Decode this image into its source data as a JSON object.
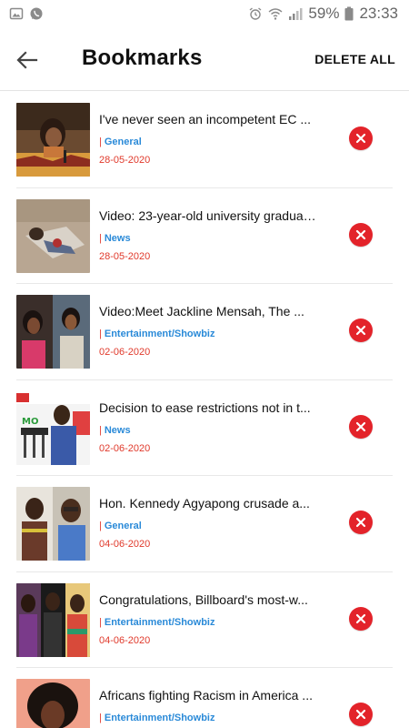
{
  "status_bar": {
    "battery_percent": "59%",
    "time": "23:33"
  },
  "header": {
    "title": "Bookmarks",
    "delete_all_label": "DELETE ALL"
  },
  "bookmarks": [
    {
      "title": "I've never seen an incompetent EC ...",
      "category": "General",
      "date": "28-05-2020"
    },
    {
      "title": "Video: 23-year-old university graduat...",
      "category": "News",
      "date": "28-05-2020"
    },
    {
      "title": "Video:Meet Jackline Mensah, The ...",
      "category": "Entertainment/Showbiz",
      "date": "02-06-2020"
    },
    {
      "title": "Decision to ease restrictions not in t...",
      "category": "News",
      "date": "02-06-2020"
    },
    {
      "title": "Hon. Kennedy Agyapong crusade a...",
      "category": "General",
      "date": "04-06-2020"
    },
    {
      "title": "Congratulations, Billboard's most-w...",
      "category": "Entertainment/Showbiz",
      "date": "04-06-2020"
    },
    {
      "title": "Africans fighting Racism in America ...",
      "category": "Entertainment/Showbiz",
      "date": ""
    }
  ],
  "colors": {
    "category": "#2a8ad8",
    "date": "#e0392b",
    "remove_button": "#e3232a"
  },
  "icons": {
    "back": "arrow-left-icon",
    "remove": "close-circle-icon"
  }
}
